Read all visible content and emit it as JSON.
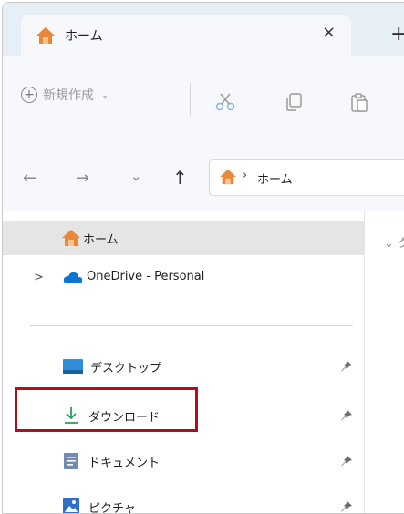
{
  "window": {
    "tab_title": "ホーム",
    "close_glyph": "×",
    "new_tab_glyph": "+"
  },
  "toolbar": {
    "new_label": "新規作成",
    "new_plus": "+",
    "new_chevron": "⌄"
  },
  "address": {
    "back": "←",
    "forward": "→",
    "recent": "⌄",
    "up": "↑",
    "separator": "›",
    "path": "ホーム"
  },
  "nav": {
    "home": "ホーム",
    "onedrive_chevron": ">",
    "onedrive": "OneDrive - Personal",
    "quick_access": [
      {
        "label": "デスクトップ",
        "icon": "desktop-icon"
      },
      {
        "label": "ダウンロード",
        "icon": "download-icon"
      },
      {
        "label": "ドキュメント",
        "icon": "documents-icon"
      },
      {
        "label": "ピクチャ",
        "icon": "pictures-icon"
      }
    ]
  },
  "content": {
    "group_chevron": "⌄",
    "group_label": "ク"
  },
  "colors": {
    "home_icon": "#e8883a",
    "highlight": "#b0101c",
    "download": "#2aa05a",
    "onedrive": "#0a74d8",
    "desktop": "#2f8fd8"
  }
}
